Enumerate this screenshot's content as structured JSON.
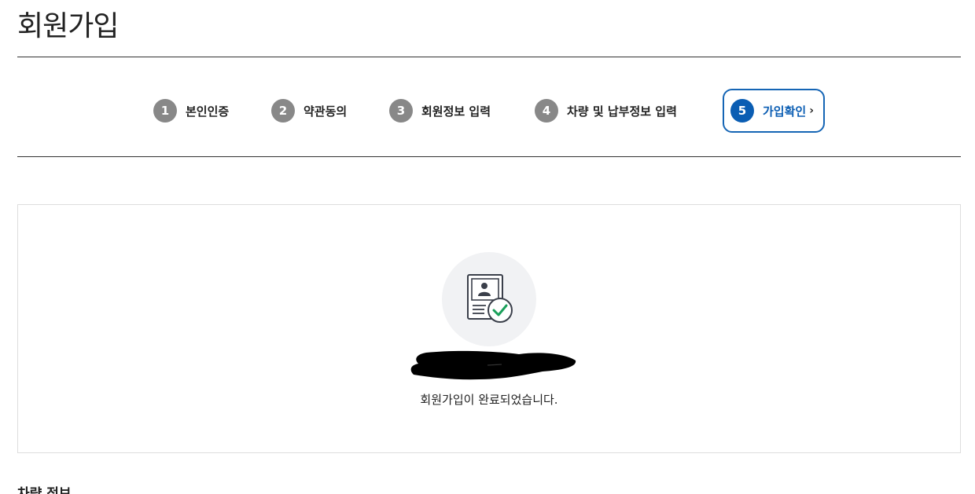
{
  "page": {
    "title": "회원가입"
  },
  "stepper": {
    "steps": [
      {
        "num": "1",
        "label": "본인인증"
      },
      {
        "num": "2",
        "label": "약관동의"
      },
      {
        "num": "3",
        "label": "회원정보 입력"
      },
      {
        "num": "4",
        "label": "차량 및 납부정보 입력"
      },
      {
        "num": "5",
        "label": "가입확인",
        "active": true,
        "chevron": "›"
      }
    ]
  },
  "result": {
    "icon": "member-card-check-icon",
    "redacted_name": true,
    "message": "회원가입이 완료되었습니다."
  },
  "next_section": {
    "title": "차량 정보"
  },
  "colors": {
    "accent": "#0a5db3",
    "step_inactive": "#888888",
    "check": "#1aa05a",
    "icon_bg": "#f1f2f4"
  }
}
